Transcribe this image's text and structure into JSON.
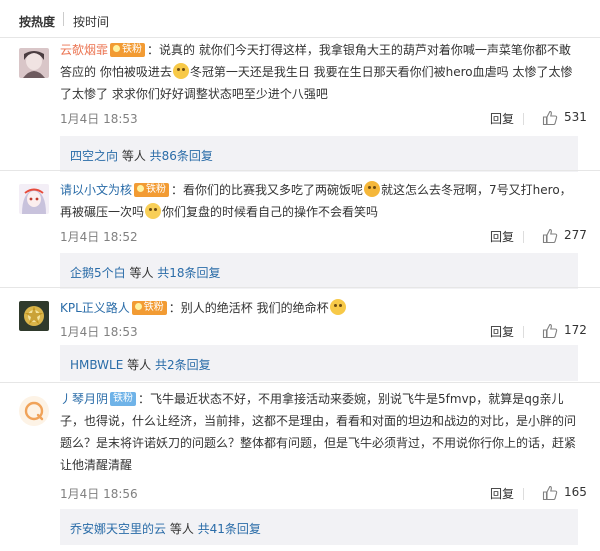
{
  "sort": {
    "hot": "按热度",
    "time": "按时间"
  },
  "comments": [
    {
      "username": "云欹烟霏",
      "badge": "铁粉",
      "text_a": "：说真的 就你们今天打得这样，我拿银角大王的葫芦对着你喊一声菜笔你都不敢答应的 你怕被吸进去",
      "text_b": "冬冠第一天还是我生日 我要在生日那天看你们被hero血虐吗 太惨了太惨了太惨了 求求你们好好调整状态吧至少进个八强吧",
      "date": "1月4日 18:53",
      "reply": "回复",
      "likes": "531",
      "sub_user": "四空之向",
      "sub_mid": " 等人 ",
      "sub_link": "共86条回复"
    },
    {
      "username": "请以小文为核",
      "badge": "铁粉",
      "text_a": "：看你们的比赛我又多吃了两碗饭呢",
      "text_b": "就这怎么去冬冠啊，7号又打hero，再被碾压一次吗",
      "text_c": "你们复盘的时候看自己的操作不会看笑吗",
      "date": "1月4日 18:52",
      "reply": "回复",
      "likes": "277",
      "sub_user": "企鹅5个白",
      "sub_mid": " 等人 ",
      "sub_link": "共18条回复"
    },
    {
      "username": "KPL正义路人",
      "badge": "铁粉",
      "text_a": "：别人的绝活杯 我们的绝命杯",
      "date": "1月4日 18:53",
      "reply": "回复",
      "likes": "172",
      "sub_user": "HMBWLE",
      "sub_mid": " 等人 ",
      "sub_link": "共2条回复"
    },
    {
      "username": "丿琴月阴",
      "badge": "铁粉",
      "text_a": "：飞牛最近状态不好，不用拿接活动来委婉，别说飞牛是5fmvp，就算是qg亲儿子，也得说，什么让经济，当前排，这都不是理由，看看和对面的坦边和战边的对比，是小胖的问题么？是末将许诺妖刀的问题么？整体都有问题，但是飞牛必须背过，不用说你行你上的话，赶紧让他清醒清醒",
      "date": "1月4日 18:56",
      "reply": "回复",
      "likes": "165",
      "sub_user": "乔安娜天空里的云",
      "sub_mid": " 等人 ",
      "sub_link": "共41条回复"
    }
  ],
  "colors": {
    "username": "#eb7350",
    "link": "#2a6ca8",
    "badge": "#f29b33",
    "badge_blue": "#6fb3e8",
    "subbox_bg": "#f2f2f5"
  }
}
